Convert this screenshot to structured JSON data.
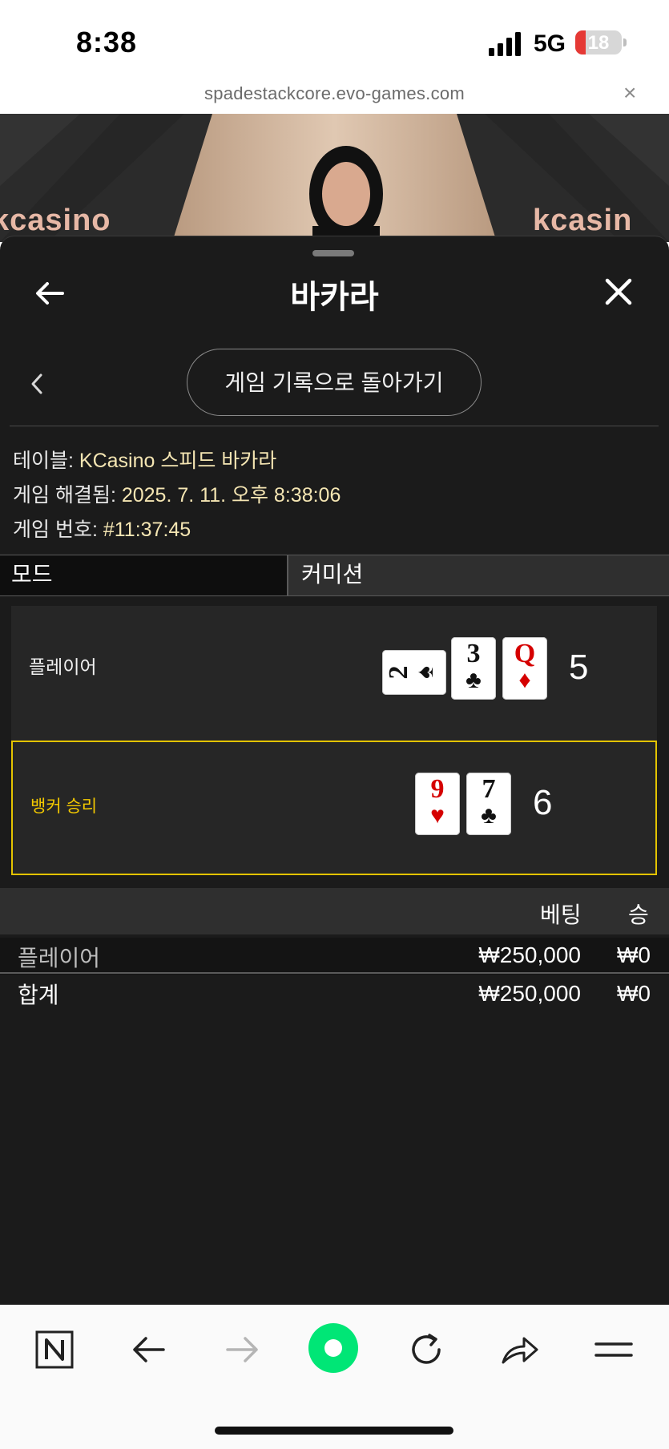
{
  "status_bar": {
    "time": "8:38",
    "network": "5G",
    "battery_level": "18"
  },
  "browser": {
    "url": "spadestackcore.evo-games.com",
    "close_glyph": "×"
  },
  "video": {
    "logo_text_left": "kcasino",
    "logo_text_right": "kcasin"
  },
  "panel": {
    "title": "바카라",
    "history_button": "게임 기록으로 돌아가기",
    "info": [
      {
        "label": "테이블: ",
        "value": "KCasino 스피드 바카라"
      },
      {
        "label": "게임 해결됨: ",
        "value": "2025. 7. 11. 오후 8:38:06"
      },
      {
        "label": "게임 번호: ",
        "value": "#11:37:45"
      }
    ],
    "tabs": {
      "mode": "모드",
      "commission": "커미션"
    },
    "hands": {
      "player": {
        "label": "플레이어",
        "score": "5",
        "cards": [
          {
            "rank": "2",
            "suit": "♠",
            "color": "black",
            "rotated": true
          },
          {
            "rank": "3",
            "suit": "♣",
            "color": "black",
            "rotated": false
          },
          {
            "rank": "Q",
            "suit": "♦",
            "color": "red",
            "rotated": false
          }
        ]
      },
      "banker": {
        "label": "뱅커 승리",
        "score": "6",
        "cards": [
          {
            "rank": "9",
            "suit": "♥",
            "color": "red",
            "rotated": false
          },
          {
            "rank": "7",
            "suit": "♣",
            "color": "black",
            "rotated": false
          }
        ]
      }
    },
    "bets": {
      "headers": {
        "bet": "베팅",
        "win": "승"
      },
      "rows": [
        {
          "name": "플레이어",
          "bet": "₩250,000",
          "win": "₩0"
        }
      ],
      "total": {
        "name": "합계",
        "bet": "₩250,000",
        "win": "₩0"
      }
    }
  },
  "colors": {
    "panel_bg": "#1b1b1b",
    "winner_border": "#e3c300",
    "winner_text": "#f3c900",
    "info_value": "#f5e6b3",
    "battery_low": "#e53935",
    "accent_green": "#00e676"
  },
  "toolbar": {
    "icons": [
      "n-logo-icon",
      "back-arrow-icon",
      "forward-arrow-icon",
      "home-circle-icon",
      "reload-icon",
      "share-icon",
      "menu-icon"
    ]
  }
}
